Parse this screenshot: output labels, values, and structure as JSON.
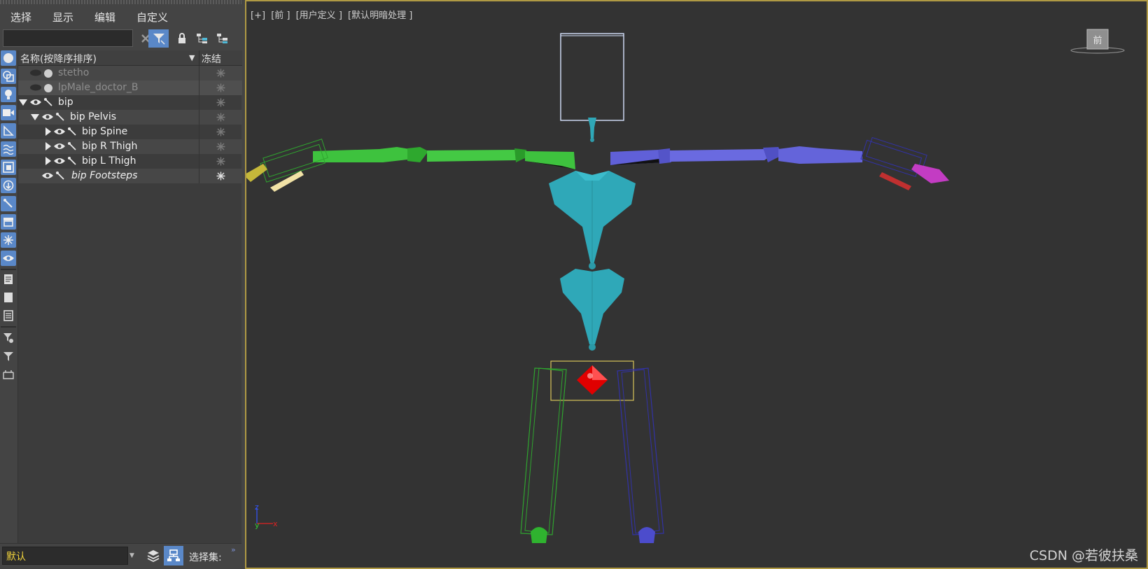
{
  "menubar": {
    "items": [
      "选择",
      "显示",
      "编辑",
      "自定义"
    ]
  },
  "search": {
    "value": "",
    "placeholder": ""
  },
  "tree": {
    "columns": {
      "name": "名称(按降序排序)",
      "freeze": "冻结"
    },
    "rows": [
      {
        "label": "stetho",
        "style": "dim"
      },
      {
        "label": "lpMale_doctor_B",
        "style": "dim"
      },
      {
        "label": "bip",
        "style": "normal"
      },
      {
        "label": "bip Pelvis",
        "style": "normal"
      },
      {
        "label": "bip Spine",
        "style": "normal"
      },
      {
        "label": "bip R Thigh",
        "style": "normal"
      },
      {
        "label": "bip L Thigh",
        "style": "normal"
      },
      {
        "label": "bip Footsteps",
        "style": "italic"
      }
    ]
  },
  "bottombar": {
    "layer": "默认",
    "selection_set_label": "选择集:",
    "more": "»"
  },
  "viewport": {
    "label_parts": [
      "[+]",
      "[前 ]",
      "[用户定义 ]",
      "[默认明暗处理 ]"
    ],
    "viewcube_face": "前",
    "axis_z": "z",
    "axis_y": "y",
    "axis_x": "x",
    "watermark": "CSDN @若彼扶桑"
  },
  "colors": {
    "accent": "#5a88c8",
    "viewport_border": "#b09a44",
    "layer_text": "#f3d53c",
    "left_arm": "#3ec23e",
    "right_arm": "#6060d8",
    "spine": "#2fa8b8",
    "pelvis_com": "#e00000"
  }
}
